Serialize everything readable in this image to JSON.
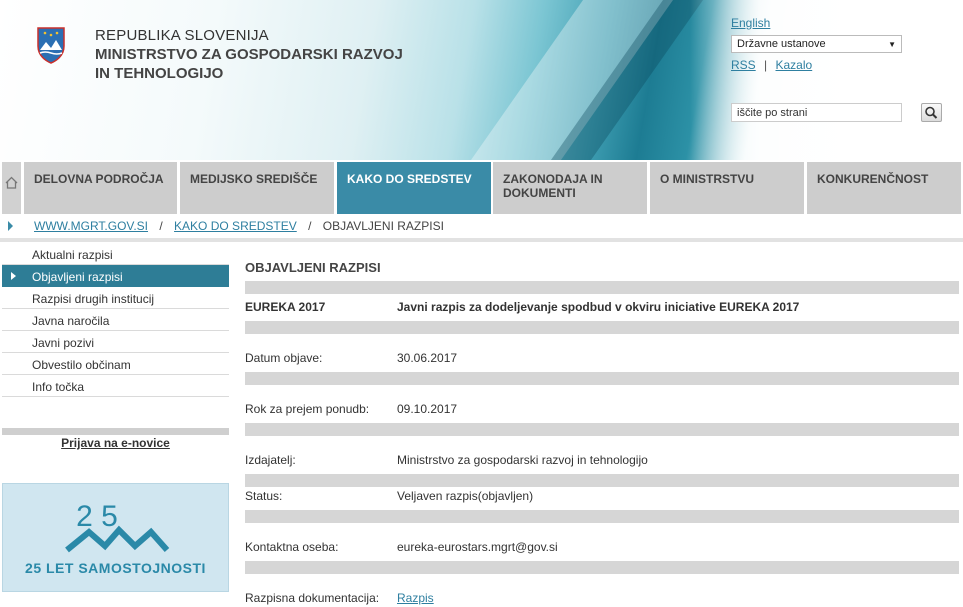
{
  "header": {
    "org_line1": "REPUBLIKA SLOVENIJA",
    "org_line2": "MINISTRSTVO ZA GOSPODARSKI RAZVOJ IN TEHNOLOGIJO",
    "language_link": "English",
    "institutions_select": {
      "selected": "Državne ustanove"
    },
    "rss_label": "RSS",
    "separator": "|",
    "kazalo_label": "Kazalo",
    "search": {
      "value": "iščite po strani"
    }
  },
  "nav": {
    "tabs": [
      {
        "label": "DELOVNA PODROČJA"
      },
      {
        "label": "MEDIJSKO SREDIŠČE"
      },
      {
        "label": "KAKO DO SREDSTEV"
      },
      {
        "label": "ZAKONODAJA IN DOKUMENTI"
      },
      {
        "label": "O MINISTRSTVU"
      },
      {
        "label": "KONKURENČNOST"
      }
    ],
    "active_index": 2
  },
  "breadcrumb": {
    "items": [
      "WWW.MGRT.GOV.SI",
      "KAKO DO SREDSTEV",
      "OBJAVLJENI RAZPISI"
    ],
    "separator": "/"
  },
  "sidebar": {
    "items": [
      {
        "label": "Aktualni razpisi"
      },
      {
        "label": "Objavljeni razpisi"
      },
      {
        "label": "Razpisi drugih institucij"
      },
      {
        "label": "Javna naročila"
      },
      {
        "label": "Javni pozivi"
      },
      {
        "label": "Obvestilo občinam"
      },
      {
        "label": "Info točka"
      }
    ],
    "active_index": 1,
    "enovice_link": "Prijava na e-novice",
    "banner": {
      "digits": "2 5",
      "text": "25 LET SAMOSTOJNOSTI"
    }
  },
  "main": {
    "title": "OBJAVLJENI RAZPISI",
    "rows": [
      {
        "label": "EUREKA 2017",
        "value": "Javni razpis za dodeljevanje spodbud v okviru iniciative EUREKA 2017"
      },
      {
        "label": "Datum objave:",
        "value": "30.06.2017"
      },
      {
        "label": "Rok za prejem ponudb:",
        "value": "09.10.2017"
      },
      {
        "label": "Izdajatelj:",
        "value": "Ministrstvo za gospodarski razvoj in tehnologijo"
      },
      {
        "label": "Status:",
        "value": "Veljaven razpis(objavljen)"
      },
      {
        "label": "Kontaktna oseba:",
        "value": "eureka-eurostars.mgrt@gov.si"
      },
      {
        "label": "Razpisna dokumentacija:",
        "value": "Razpis"
      }
    ]
  },
  "colors": {
    "accent": "#3a8ba7",
    "link": "#2e7fa0",
    "tab_bg": "#cdcdcd"
  }
}
